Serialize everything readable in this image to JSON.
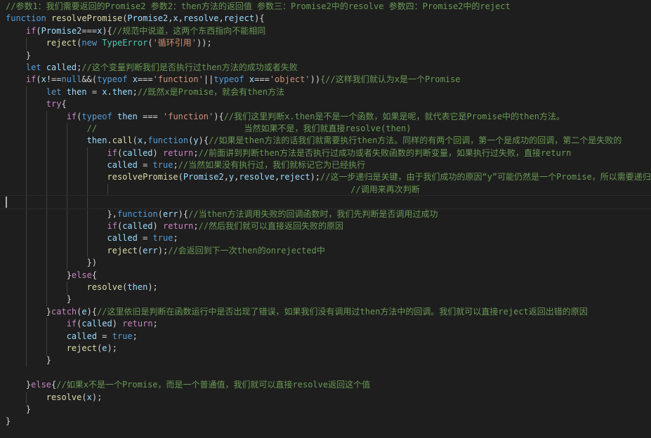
{
  "editor": {
    "theme_colors": {
      "background": "#1e1e1e",
      "keyword": "#569cd6",
      "control": "#c586c0",
      "function": "#dcdcaa",
      "variable": "#9cdcfe",
      "string": "#ce9178",
      "comment": "#6a9955",
      "type": "#4ec9b0",
      "plain": "#d4d4d4"
    },
    "lines": [
      [
        [
          "cmt",
          "//参数1：我们需要返回的Promise2 参数2：then方法的返回值 参数三：Promise2中的resolve 参数四：Promise2中的reject"
        ]
      ],
      [
        [
          "kw",
          "function "
        ],
        [
          "fn",
          "resolvePromise"
        ],
        [
          "plain",
          "("
        ],
        [
          "var",
          "Promise2"
        ],
        [
          "plain",
          ","
        ],
        [
          "var",
          "x"
        ],
        [
          "plain",
          ","
        ],
        [
          "var",
          "resolve"
        ],
        [
          "plain",
          ","
        ],
        [
          "var",
          "reject"
        ],
        [
          "plain",
          "){"
        ]
      ],
      [
        [
          "plain",
          "    "
        ],
        [
          "ctl",
          "if"
        ],
        [
          "plain",
          "("
        ],
        [
          "var",
          "Promise2"
        ],
        [
          "plain",
          "==="
        ],
        [
          "var",
          "x"
        ],
        [
          "plain",
          "){"
        ],
        [
          "cmt",
          "//规范中说道，这两个东西指向不能相同"
        ]
      ],
      [
        [
          "plain",
          "        "
        ],
        [
          "fn",
          "reject"
        ],
        [
          "plain",
          "("
        ],
        [
          "kw",
          "new "
        ],
        [
          "type",
          "TypeError"
        ],
        [
          "plain",
          "("
        ],
        [
          "str",
          "'循环引用'"
        ],
        [
          "plain",
          "));"
        ]
      ],
      [
        [
          "plain",
          "    }"
        ]
      ],
      [
        [
          "plain",
          "    "
        ],
        [
          "kw",
          "let "
        ],
        [
          "var",
          "called"
        ],
        [
          "plain",
          ";"
        ],
        [
          "cmt",
          "//这个变量判断我们是否执行过then方法的成功或者失败"
        ]
      ],
      [
        [
          "plain",
          "    "
        ],
        [
          "ctl",
          "if"
        ],
        [
          "plain",
          "("
        ],
        [
          "var",
          "x"
        ],
        [
          "plain",
          "!=="
        ],
        [
          "kw",
          "null"
        ],
        [
          "plain",
          "&&("
        ],
        [
          "kw",
          "typeof "
        ],
        [
          "var",
          "x"
        ],
        [
          "plain",
          "==="
        ],
        [
          "str",
          "'function'"
        ],
        [
          "plain",
          "||"
        ],
        [
          "kw",
          "typeof "
        ],
        [
          "var",
          "x"
        ],
        [
          "plain",
          "==="
        ],
        [
          "str",
          "'object'"
        ],
        [
          "plain",
          "))"
        ],
        [
          "cmt",
          "{//这样我们就认为x是一个Promise"
        ]
      ],
      [
        [
          "plain",
          "        "
        ],
        [
          "kw",
          "let "
        ],
        [
          "var",
          "then"
        ],
        [
          "plain",
          " = "
        ],
        [
          "var",
          "x"
        ],
        [
          "plain",
          "."
        ],
        [
          "var",
          "then"
        ],
        [
          "plain",
          ";"
        ],
        [
          "cmt",
          "//既然x是Promise，就会有then方法"
        ]
      ],
      [
        [
          "plain",
          "        "
        ],
        [
          "ctl",
          "try"
        ],
        [
          "plain",
          "{"
        ]
      ],
      [
        [
          "plain",
          "            "
        ],
        [
          "ctl",
          "if"
        ],
        [
          "plain",
          "("
        ],
        [
          "kw",
          "typeof "
        ],
        [
          "var",
          "then"
        ],
        [
          "plain",
          " === "
        ],
        [
          "str",
          "'function'"
        ],
        [
          "plain",
          "){"
        ],
        [
          "cmt",
          "//我们这里判断x.then是不是一个函数，如果是呢，就代表它是Promise中的then方法。"
        ]
      ],
      [
        [
          "plain",
          "                "
        ],
        [
          "cmt",
          "//                             当然如果不是，我们就直接resolve(then)"
        ]
      ],
      [
        [
          "plain",
          "                "
        ],
        [
          "var",
          "then"
        ],
        [
          "plain",
          "."
        ],
        [
          "fn",
          "call"
        ],
        [
          "plain",
          "("
        ],
        [
          "var",
          "x"
        ],
        [
          "plain",
          ","
        ],
        [
          "kw",
          "function"
        ],
        [
          "plain",
          "("
        ],
        [
          "var",
          "y"
        ],
        [
          "plain",
          "){"
        ],
        [
          "cmt",
          "//如果是then方法的话我们就需要执行then方法。同样的有两个回调，第一个是成功的回调，第二个是失败的"
        ]
      ],
      [
        [
          "plain",
          "                    "
        ],
        [
          "ctl",
          "if"
        ],
        [
          "plain",
          "("
        ],
        [
          "var",
          "called"
        ],
        [
          "plain",
          ") "
        ],
        [
          "ctl",
          "return"
        ],
        [
          "plain",
          ";"
        ],
        [
          "cmt",
          "//前面讲到判断then方法是否执行过成功或者失败函数的判断变量，如果执行过失败，直接return"
        ]
      ],
      [
        [
          "plain",
          "                    "
        ],
        [
          "var",
          "called"
        ],
        [
          "plain",
          " = "
        ],
        [
          "kw",
          "true"
        ],
        [
          "plain",
          ";"
        ],
        [
          "cmt",
          "//当然如果没有执行过，我们就标记它为已经执行"
        ]
      ],
      [
        [
          "plain",
          "                    "
        ],
        [
          "fn",
          "resolvePromise"
        ],
        [
          "plain",
          "("
        ],
        [
          "var",
          "Promise2"
        ],
        [
          "plain",
          ","
        ],
        [
          "var",
          "y"
        ],
        [
          "plain",
          ","
        ],
        [
          "var",
          "resolve"
        ],
        [
          "plain",
          ","
        ],
        [
          "var",
          "reject"
        ],
        [
          "plain",
          ");"
        ],
        [
          "cmt",
          "//这一步递归是关键，由于我们成功的原因“y”可能仍然是一个Promise，所以需要递归"
        ]
      ],
      [
        [
          "plain",
          "                                                                    "
        ],
        [
          "cmt",
          "//调用来再次判断"
        ]
      ],
      [
        [
          "plain",
          ""
        ]
      ],
      [
        [
          "plain",
          "                    },"
        ],
        [
          "kw",
          "function"
        ],
        [
          "plain",
          "("
        ],
        [
          "var",
          "err"
        ],
        [
          "plain",
          "){"
        ],
        [
          "cmt",
          "//当then方法调用失败的回调函数时，我们先判断是否调用过成功"
        ]
      ],
      [
        [
          "plain",
          "                    "
        ],
        [
          "ctl",
          "if"
        ],
        [
          "plain",
          "("
        ],
        [
          "var",
          "called"
        ],
        [
          "plain",
          ") "
        ],
        [
          "ctl",
          "return"
        ],
        [
          "plain",
          ";"
        ],
        [
          "cmt",
          "//然后我们就可以直接返回失败的原因"
        ]
      ],
      [
        [
          "plain",
          "                    "
        ],
        [
          "var",
          "called"
        ],
        [
          "plain",
          " = "
        ],
        [
          "kw",
          "true"
        ],
        [
          "plain",
          ";"
        ]
      ],
      [
        [
          "plain",
          "                    "
        ],
        [
          "fn",
          "reject"
        ],
        [
          "plain",
          "("
        ],
        [
          "var",
          "err"
        ],
        [
          "plain",
          ");"
        ],
        [
          "cmt",
          "//会返回到下一次then的onrejected中"
        ]
      ],
      [
        [
          "plain",
          "                })"
        ]
      ],
      [
        [
          "plain",
          "            }"
        ],
        [
          "ctl",
          "else"
        ],
        [
          "plain",
          "{"
        ]
      ],
      [
        [
          "plain",
          "                "
        ],
        [
          "fn",
          "resolve"
        ],
        [
          "plain",
          "("
        ],
        [
          "var",
          "then"
        ],
        [
          "plain",
          ");"
        ]
      ],
      [
        [
          "plain",
          "            }"
        ]
      ],
      [
        [
          "plain",
          "        }"
        ],
        [
          "ctl",
          "catch"
        ],
        [
          "plain",
          "("
        ],
        [
          "var",
          "e"
        ],
        [
          "plain",
          "){"
        ],
        [
          "cmt",
          "//这里依旧是判断在函数运行中是否出现了错误，如果我们没有调用过then方法中的回调。我们就可以直接reject返回出错的原因"
        ]
      ],
      [
        [
          "plain",
          "            "
        ],
        [
          "ctl",
          "if"
        ],
        [
          "plain",
          "("
        ],
        [
          "var",
          "called"
        ],
        [
          "plain",
          ") "
        ],
        [
          "ctl",
          "return"
        ],
        [
          "plain",
          ";"
        ]
      ],
      [
        [
          "plain",
          "            "
        ],
        [
          "var",
          "called"
        ],
        [
          "plain",
          " = "
        ],
        [
          "kw",
          "true"
        ],
        [
          "plain",
          ";"
        ]
      ],
      [
        [
          "plain",
          "            "
        ],
        [
          "fn",
          "reject"
        ],
        [
          "plain",
          "("
        ],
        [
          "var",
          "e"
        ],
        [
          "plain",
          ");"
        ]
      ],
      [
        [
          "plain",
          "        }"
        ]
      ],
      [
        [
          "plain",
          ""
        ]
      ],
      [
        [
          "plain",
          "    }"
        ],
        [
          "ctl",
          "else"
        ],
        [
          "plain",
          "{"
        ],
        [
          "cmt",
          "//如果x不是一个Promise，而是一个普通值，我们就可以直接resolve返回这个值"
        ]
      ],
      [
        [
          "plain",
          "        "
        ],
        [
          "fn",
          "resolve"
        ],
        [
          "plain",
          "("
        ],
        [
          "var",
          "x"
        ],
        [
          "plain",
          ");"
        ]
      ],
      [
        [
          "plain",
          "    }"
        ]
      ],
      [
        [
          "plain",
          "}"
        ]
      ]
    ]
  }
}
